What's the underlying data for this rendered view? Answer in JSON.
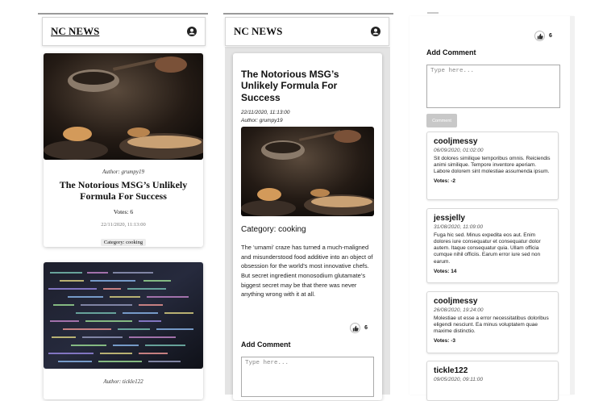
{
  "brand": "NC NEWS",
  "feed": {
    "card1": {
      "author": "Author: grumpy19",
      "title": "The Notorious MSG’s Unlikely Formula For Success",
      "votes": "Votes: 6",
      "date": "22/11/2020, 11:13:00",
      "category": "Category: cooking"
    },
    "card2": {
      "author": "Author: tickle122"
    }
  },
  "article": {
    "title": "The Notorious MSG’s Unlikely Formula For Success",
    "date": "22/11/2020, 11:13:00",
    "author": "Author: grumpy19",
    "category": "Category: cooking",
    "body": "The ‘umami’ craze has turned a much-maligned and misunderstood food additive into an object of obsession for the world’s most innovative chefs. But secret ingredient monosodium glutamate’s biggest secret may be that there was never anything wrong with it at all.",
    "votes": "6",
    "add_comment": "Add Comment",
    "placeholder": "Type here..."
  },
  "comments_panel": {
    "votes": "6",
    "add_comment": "Add Comment",
    "placeholder": "Type here...",
    "submit_label": "Comment",
    "comments": [
      {
        "author": "cooljmessy",
        "date": "06/09/2020, 01:02:00",
        "body": "Sit dolores similique temporibus omnis. Reiciendis animi similique. Tempore inventore aperiam. Labore dolorem sint molestiae assumenda ipsum.",
        "votes": "Votes: -2"
      },
      {
        "author": "jessjelly",
        "date": "31/08/2020, 11:09:00",
        "body": "Fuga hic sed. Minus expedita eos aut. Enim dolores iure consequatur et consequatur dolor autem. Itaque consequatur quia. Ullam officia cumque nihil officiis. Earum error iure sed non earum.",
        "votes": "Votes: 14"
      },
      {
        "author": "cooljmessy",
        "date": "26/08/2020, 19:24:00",
        "body": "Molestiae ut esse a error necessitatibus doloribus eligendi nesciunt. Ea minus voluptatem quae maxime distinctio.",
        "votes": "Votes: -3"
      },
      {
        "author": "tickle122",
        "date": "09/05/2020, 09:11:00"
      }
    ]
  },
  "colors": {
    "background": "#ffffff",
    "card_border": "#d6d6d6",
    "button_disabled": "#c8c8c8"
  },
  "icons": {
    "user": "user-circle-icon",
    "like": "thumbs-up-icon"
  }
}
